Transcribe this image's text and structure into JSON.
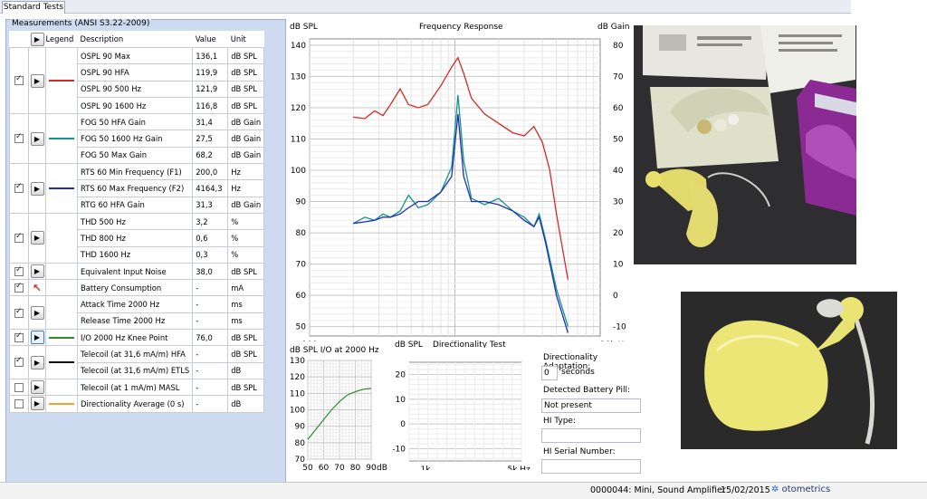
{
  "tab": {
    "label": "Standard Tests"
  },
  "measurements": {
    "title": "Measurements (ANSI S3.22-2009)",
    "headers": {
      "legend": "Legend",
      "description": "Description",
      "value": "Value",
      "unit": "Unit"
    },
    "rows": [
      {
        "desc": "OSPL 90 Max",
        "value": "136,1",
        "unit": "dB SPL"
      },
      {
        "desc": "OSPL 90 HFA",
        "value": "119,9",
        "unit": "dB SPL"
      },
      {
        "desc": "OSPL 90 500 Hz",
        "value": "121,9",
        "unit": "dB SPL"
      },
      {
        "desc": "OSPL 90 1600 Hz",
        "value": "116,8",
        "unit": "dB SPL"
      },
      {
        "desc": "FOG 50 HFA Gain",
        "value": "31,4",
        "unit": "dB Gain"
      },
      {
        "desc": "FOG 50 1600 Hz Gain",
        "value": "27,5",
        "unit": "dB Gain"
      },
      {
        "desc": "FOG 50 Max Gain",
        "value": "68,2",
        "unit": "dB Gain"
      },
      {
        "desc": "RTS 60 Min Frequency (F1)",
        "value": "200,0",
        "unit": "Hz"
      },
      {
        "desc": "RTS 60 Max Frequency (F2)",
        "value": "4164,3",
        "unit": "Hz"
      },
      {
        "desc": "RTG 60 HFA Gain",
        "value": "31,3",
        "unit": "dB Gain"
      },
      {
        "desc": "THD 500 Hz",
        "value": "3,2",
        "unit": "%"
      },
      {
        "desc": "THD 800 Hz",
        "value": "0,6",
        "unit": "%"
      },
      {
        "desc": "THD 1600 Hz",
        "value": "0,3",
        "unit": "%"
      },
      {
        "desc": "Equivalent Input Noise",
        "value": "38,0",
        "unit": "dB SPL"
      },
      {
        "desc": "Battery Consumption",
        "value": "-",
        "unit": "mA"
      },
      {
        "desc": "Attack Time 2000 Hz",
        "value": "-",
        "unit": "ms"
      },
      {
        "desc": "Release Time 2000 Hz",
        "value": "-",
        "unit": "ms"
      },
      {
        "desc": "I/O 2000 Hz Knee Point",
        "value": "76,0",
        "unit": "dB SPL"
      },
      {
        "desc": "Telecoil (at 31,6 mA/m) HFA",
        "value": "-",
        "unit": "dB SPL"
      },
      {
        "desc": "Telecoil (at 31,6 mA/m) ETLS",
        "value": "-",
        "unit": "dB"
      },
      {
        "desc": "Telecoil (at 1 mA/m) MASL",
        "value": "-",
        "unit": "dB SPL"
      },
      {
        "desc": "Directionality Average (0 s)",
        "value": "-",
        "unit": "dB"
      }
    ]
  },
  "colors": {
    "ospl": "#d62828",
    "fog": "#12948c",
    "rts": "#1f2fb0",
    "io": "#2e8b2e",
    "telecoil": "#111111",
    "dir": "#f0a030"
  },
  "freq": {
    "title": "Frequency Response",
    "left_unit": "dB SPL",
    "right_unit": "dB Gain",
    "y_ticks": [
      "140",
      "130",
      "120",
      "110",
      "100",
      "90",
      "80",
      "70",
      "60",
      "50"
    ],
    "r_ticks": [
      "80",
      "70",
      "60",
      "50",
      "40",
      "30",
      "20",
      "10",
      "0",
      "-10"
    ],
    "x_ticks": [
      "100",
      "1k",
      "10k Hz"
    ]
  },
  "io": {
    "title": "dB SPL I/O at 2000 Hz",
    "y_ticks": [
      "130",
      "120",
      "110",
      "100",
      "90",
      "80",
      "70"
    ],
    "x_ticks": [
      "50",
      "60",
      "70",
      "80",
      "90",
      "dB"
    ]
  },
  "dir": {
    "ylabel": "dB SPL",
    "title": "Directionality Test",
    "y_ticks": [
      "20",
      "10",
      "0",
      "-10"
    ],
    "x_ticks": [
      "1k",
      "5k",
      "Hz"
    ]
  },
  "info": {
    "adapt_label": "Directionality Adaptation:",
    "adapt_value": "0",
    "adapt_unit": "seconds",
    "battery_label": "Detected Battery Pill:",
    "battery_value": "Not present",
    "hi_type_label": "HI Type:",
    "hi_type_value": "",
    "serial_label": "HI Serial Number:",
    "serial_value": ""
  },
  "status": {
    "record": "0000044: Mini, Sound Amplifier",
    "date": "15/02/2015",
    "brand": "otometrics"
  },
  "chart_data": [
    {
      "type": "line",
      "title": "Frequency Response",
      "xlabel": "",
      "ylabel": "dB SPL",
      "xscale": "log",
      "xlim": [
        100,
        10000
      ],
      "ylim": [
        47,
        142
      ],
      "y2label": "dB Gain",
      "y2lim": [
        -13,
        82
      ],
      "series": [
        {
          "color": "#d62828",
          "axis": "left",
          "x": [
            200,
            240,
            280,
            320,
            360,
            420,
            480,
            560,
            650,
            800,
            950,
            1050,
            1150,
            1300,
            1600,
            2000,
            2500,
            3000,
            3500,
            4000,
            4500,
            5000,
            6000
          ],
          "y": [
            117,
            116.5,
            119,
            117.5,
            121,
            126,
            121,
            120,
            121,
            127,
            133,
            136,
            131,
            123,
            118,
            115,
            112,
            111,
            114,
            109,
            100,
            86,
            65
          ]
        },
        {
          "color": "#12948c",
          "axis": "right",
          "x": [
            200,
            240,
            280,
            320,
            360,
            420,
            480,
            560,
            650,
            800,
            950,
            1050,
            1150,
            1300,
            1600,
            2000,
            2500,
            3000,
            3500,
            3800,
            4200,
            5000,
            6000
          ],
          "y": [
            23,
            25,
            24,
            26,
            25,
            27,
            32,
            28,
            29,
            33,
            41,
            64,
            43,
            31,
            29,
            31,
            27,
            25,
            22,
            26,
            18,
            2,
            -10
          ]
        },
        {
          "color": "#1f2fb0",
          "axis": "right",
          "x": [
            200,
            240,
            280,
            320,
            360,
            420,
            480,
            560,
            650,
            800,
            950,
            1050,
            1150,
            1300,
            1600,
            2000,
            2500,
            3000,
            3500,
            3800,
            4200,
            5000,
            6000
          ],
          "y": [
            23,
            23.5,
            24,
            25,
            25,
            26,
            28,
            30,
            30,
            33,
            38,
            58,
            38,
            30,
            30,
            29,
            27,
            24,
            22,
            25,
            17,
            0,
            -12
          ]
        }
      ]
    },
    {
      "type": "line",
      "title": "dB SPL I/O at 2000 Hz",
      "xlabel": "dB",
      "ylabel": "dB SPL",
      "xlim": [
        50,
        90
      ],
      "ylim": [
        70,
        130
      ],
      "series": [
        {
          "color": "#2e8b2e",
          "x": [
            50,
            55,
            60,
            65,
            70,
            75,
            80,
            85,
            90
          ],
          "y": [
            82,
            88,
            94,
            100,
            105,
            109,
            111,
            112.5,
            113
          ]
        }
      ]
    }
  ]
}
